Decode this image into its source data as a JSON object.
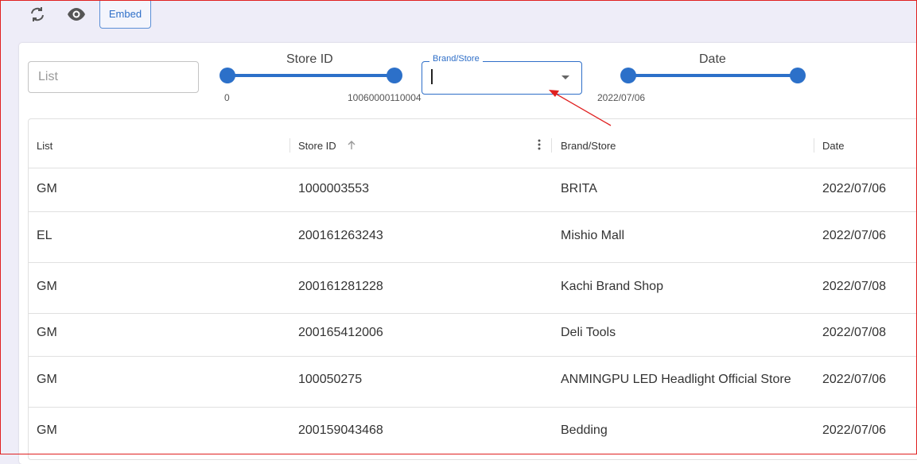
{
  "toolbar": {
    "refresh_icon": "refresh-icon",
    "preview_icon": "eye-icon",
    "embed_label": "Embed"
  },
  "filters": {
    "list_placeholder": "List",
    "store_id": {
      "title": "Store ID",
      "min_label": "0",
      "max_label": "10060000110004"
    },
    "brand_store": {
      "label": "Brand/Store",
      "value": ""
    },
    "date": {
      "title": "Date",
      "min_label": "2022/07/06"
    }
  },
  "table": {
    "columns": [
      "List",
      "Store ID",
      "Brand/Store",
      "Date"
    ],
    "sort_icon": "arrow-up-icon",
    "column_menu_icon": "more-vertical-icon",
    "rows": [
      {
        "list": "GM",
        "store_id": "1000003553",
        "brand": "BRITA",
        "date": "2022/07/06"
      },
      {
        "list": "EL",
        "store_id": "200161263243",
        "brand": "Mishio Mall",
        "date": "2022/07/06"
      },
      {
        "list": "GM",
        "store_id": "200161281228",
        "brand": "Kachi Brand Shop",
        "date": "2022/07/08"
      },
      {
        "list": "GM",
        "store_id": "200165412006",
        "brand": "Deli Tools",
        "date": "2022/07/08"
      },
      {
        "list": "GM",
        "store_id": "100050275",
        "brand": "ANMINGPU LED Headlight Official Store",
        "date": "2022/07/06"
      },
      {
        "list": "GM",
        "store_id": "200159043468",
        "brand": "Bedding",
        "date": "2022/07/06"
      }
    ]
  },
  "colors": {
    "accent": "#2c70c9",
    "annotation": "#e02020"
  }
}
